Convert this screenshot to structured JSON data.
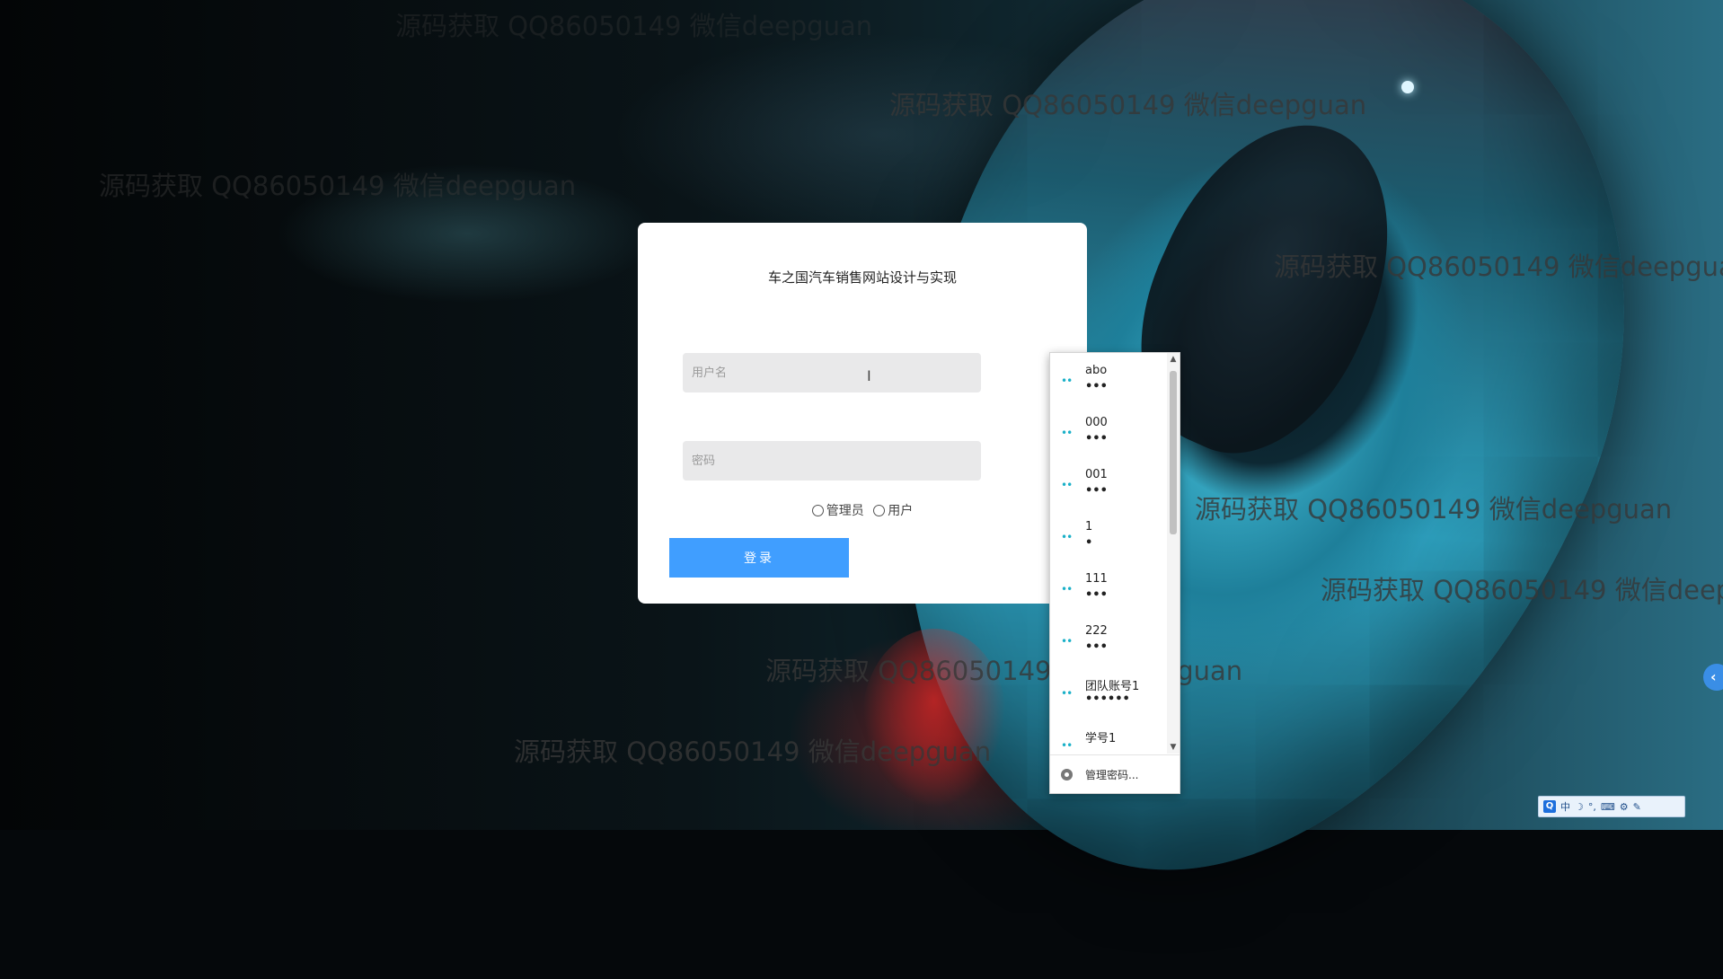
{
  "app": {
    "title": "车之国汽车销售网站设计与实现"
  },
  "watermarks": [
    "源码获取 QQ86050149 微信deepguan",
    "源码获取 QQ86050149 微信deepguan",
    "源码获取 QQ86050149 微信deepguan",
    "源码获取 QQ86050149 微信deepguan",
    "源码获取 QQ86050149 微信deepguan",
    "源码获取 QQ86050149 微信deepguan",
    "源码获取 QQ86050149 微信deepguan",
    "源码获取 QQ86050149 微信deepguan",
    "源码获取 QQ86050149 微信deepguan"
  ],
  "login": {
    "title": "车之国汽车销售网站设计与实现",
    "username_placeholder": "用户名",
    "password_placeholder": "密码",
    "roles": [
      "管理员",
      "用户"
    ],
    "submit_label": "登录"
  },
  "password_dropdown": {
    "items": [
      {
        "username": "abo",
        "password_mask": "•••"
      },
      {
        "username": "000",
        "password_mask": "•••"
      },
      {
        "username": "001",
        "password_mask": "•••"
      },
      {
        "username": "1",
        "password_mask": "•"
      },
      {
        "username": "111",
        "password_mask": "•••"
      },
      {
        "username": "222",
        "password_mask": "•••"
      },
      {
        "username": "团队账号1",
        "password_mask": "••••••"
      },
      {
        "username": "学号1",
        "password_mask": ""
      }
    ],
    "manage_label": "管理密码..."
  },
  "side_toggle": {
    "icon": "chevron-left-icon",
    "glyph": "‹"
  },
  "ime": {
    "logo": "Q",
    "mode": "中",
    "icons": [
      "moon-icon",
      "punctuation-icon",
      "keyboard-icon",
      "settings-icon",
      "wrench-icon"
    ],
    "glyphs": [
      "☽",
      "°,",
      "⌨",
      "⚙",
      "✎"
    ]
  },
  "colors": {
    "accent": "#409eff",
    "card_bg": "#ffffff",
    "field_bg": "#e9e9ea"
  }
}
